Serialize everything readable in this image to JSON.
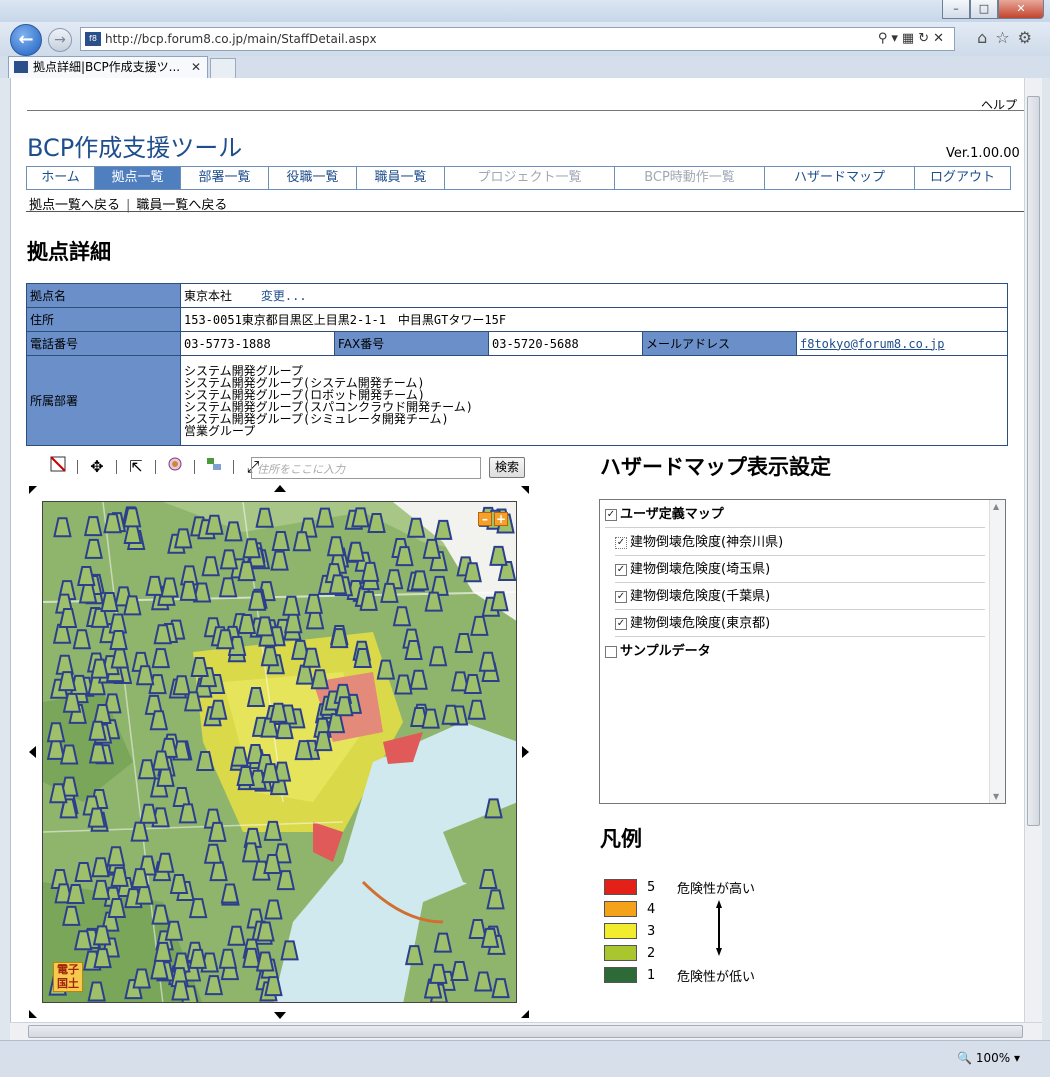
{
  "browser": {
    "url": "http://bcp.forum8.co.jp/main/StaffDetail.aspx",
    "tab_title": "拠点詳細|BCP作成支援ツ...",
    "zoom": "100%"
  },
  "header": {
    "help": "ヘルプ",
    "app_title": "BCP作成支援ツール",
    "version": "Ver.1.00.00"
  },
  "nav": [
    {
      "label": "ホーム",
      "state": "normal"
    },
    {
      "label": "拠点一覧",
      "state": "active"
    },
    {
      "label": "部署一覧",
      "state": "normal"
    },
    {
      "label": "役職一覧",
      "state": "normal"
    },
    {
      "label": "職員一覧",
      "state": "normal"
    },
    {
      "label": "プロジェクト一覧",
      "state": "disabled"
    },
    {
      "label": "BCP時動作一覧",
      "state": "disabled"
    },
    {
      "label": "ハザードマップ",
      "state": "normal"
    },
    {
      "label": "ログアウト",
      "state": "normal"
    }
  ],
  "breadcrumb": {
    "back_sites": "拠点一覧へ戻る",
    "back_staff": "職員一覧へ戻る"
  },
  "page_heading": "拠点詳細",
  "site": {
    "name_label": "拠点名",
    "name": "東京本社",
    "change_link": "変更...",
    "address_label": "住所",
    "address": "153-0051東京都目黒区上目黒2-1-1　中目黒GTタワー15F",
    "phone_label": "電話番号",
    "phone": "03-5773-1888",
    "fax_label": "FAX番号",
    "fax": "03-5720-5688",
    "email_label": "メールアドレス",
    "email": "f8tokyo@forum8.co.jp",
    "dept_label": "所属部署",
    "departments": [
      "システム開発グループ",
      "システム開発グループ(システム開発チーム)",
      "システム開発グループ(ロボット開発チーム)",
      "システム開発グループ(スパコンクラウド開発チーム)",
      "システム開発グループ(シミュレータ開発チーム)",
      "営業グループ"
    ]
  },
  "map": {
    "search_placeholder": "住所をここに入力",
    "search_button": "検索",
    "badge_line1": "電子",
    "badge_line2": "国土"
  },
  "hazard": {
    "heading": "ハザードマップ表示設定",
    "items": [
      {
        "label": "ユーザ定義マップ",
        "checked": true,
        "indent": 0,
        "bold": true
      },
      {
        "label": "建物倒壊危険度(神奈川県)",
        "checked": true,
        "indent": 1,
        "bold": false
      },
      {
        "label": "建物倒壊危険度(埼玉県)",
        "checked": true,
        "indent": 1,
        "bold": false
      },
      {
        "label": "建物倒壊危険度(千葉県)",
        "checked": true,
        "indent": 1,
        "bold": false
      },
      {
        "label": "建物倒壊危険度(東京都)",
        "checked": true,
        "indent": 1,
        "bold": false
      },
      {
        "label": "サンプルデータ",
        "checked": false,
        "indent": 0,
        "bold": true
      }
    ]
  },
  "legend": {
    "heading": "凡例",
    "rows": [
      {
        "level": "5",
        "color": "#e32119",
        "label": "危険性が高い"
      },
      {
        "level": "4",
        "color": "#f5a21b",
        "label": ""
      },
      {
        "level": "3",
        "color": "#f2ec2e",
        "label": ""
      },
      {
        "level": "2",
        "color": "#a9c62e",
        "label": ""
      },
      {
        "level": "1",
        "color": "#2d6a38",
        "label": "危険性が低い"
      }
    ]
  }
}
